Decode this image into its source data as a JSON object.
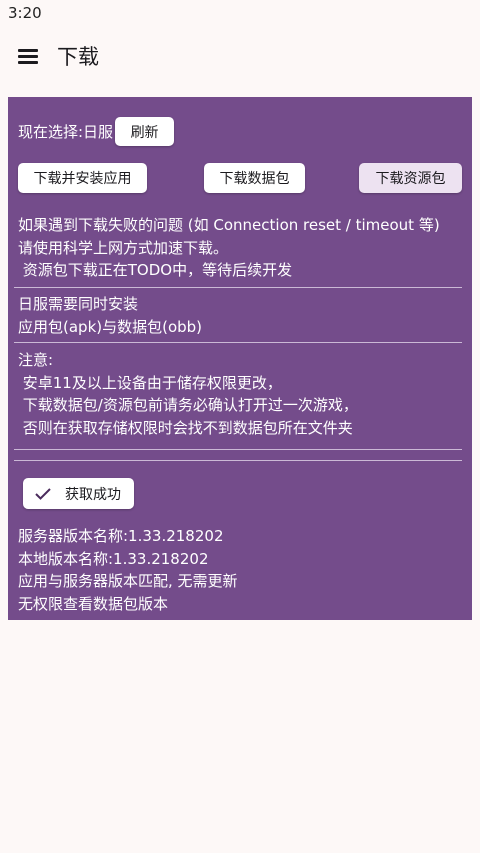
{
  "status_bar": {
    "time": "3:20"
  },
  "header": {
    "title": "下载",
    "menu_icon": "hamburger-menu-icon"
  },
  "panel": {
    "background": "#744c8b",
    "select_label": "现在选择:日服",
    "refresh_label": "刷新",
    "buttons": {
      "download_install_app": "下载并安装应用",
      "download_data": "下载数据包",
      "download_resource": "下载资源包"
    },
    "notice1": [
      "如果遇到下载失败的问题 (如 Connection reset / timeout 等)",
      "请使用科学上网方式加速下载。",
      " 资源包下载正在TODO中，等待后续开发"
    ],
    "notice2": [
      "日服需要同时安装",
      "应用包(apk)与数据包(obb)"
    ],
    "notice3": [
      "注意:",
      " 安卓11及以上设备由于储存权限更改，",
      " 下载数据包/资源包前请务必确认打开过一次游戏，",
      " 否则在获取存储权限时会找不到数据包所在文件夹"
    ],
    "success_button": {
      "label": "获取成功",
      "icon": "check-icon"
    },
    "version_info": [
      "服务器版本名称:1.33.218202",
      "本地版本名称:1.33.218202",
      "应用与服务器版本匹配, 无需更新",
      "无权限查看数据包版本"
    ]
  }
}
